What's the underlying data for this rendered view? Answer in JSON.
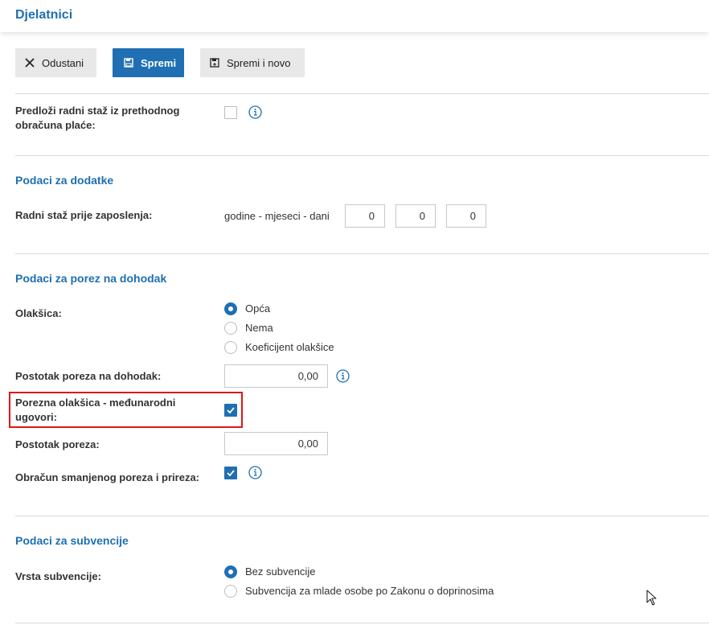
{
  "header": {
    "title": "Djelatnici"
  },
  "toolbar": {
    "cancel_label": "Odustani",
    "save_label": "Spremi",
    "save_new_label": "Spremi i novo"
  },
  "fields": {
    "previous_service": {
      "label_line1": "Predloži radni staž iz prethodnog",
      "label_line2": "obračuna plaće:",
      "checked": false
    },
    "section_allowances": "Podaci za dodatke",
    "service_before": {
      "label": "Radni staž prije zaposlenja:",
      "hint": "godine - mjeseci - dani",
      "years": "0",
      "months": "0",
      "days": "0"
    },
    "section_income_tax": "Podaci za porez na dohodak",
    "relief": {
      "label": "Olakšica:",
      "options": [
        "Opća",
        "Nema",
        "Koeficijent olakšice"
      ],
      "selected": "Opća"
    },
    "income_tax_pct": {
      "label": "Postotak poreza na dohodak:",
      "value": "0,00"
    },
    "intl_relief": {
      "label_line1": "Porezna olakšica - međunarodni",
      "label_line2": "ugovori:",
      "checked": true
    },
    "tax_pct": {
      "label": "Postotak poreza:",
      "value": "0,00"
    },
    "reduced_tax": {
      "label": "Obračun smanjenog poreza i prireza:",
      "checked": true
    },
    "section_subsidies": "Podaci za subvencije",
    "subsidy": {
      "label": "Vrsta subvencije:",
      "options": [
        "Bez subvencije",
        "Subvencija za mlade osobe po Zakonu o doprinosima"
      ],
      "selected": "Bez subvencije"
    }
  },
  "colors": {
    "accent": "#1f6fb2",
    "highlight": "#e0161a"
  }
}
